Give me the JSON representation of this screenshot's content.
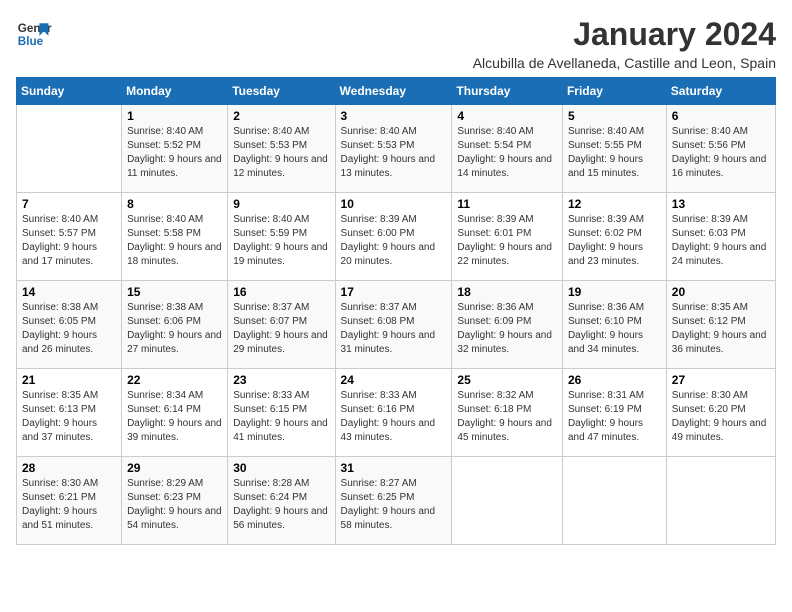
{
  "header": {
    "logo_line1": "General",
    "logo_line2": "Blue",
    "month_title": "January 2024",
    "subtitle": "Alcubilla de Avellaneda, Castille and Leon, Spain"
  },
  "days_of_week": [
    "Sunday",
    "Monday",
    "Tuesday",
    "Wednesday",
    "Thursday",
    "Friday",
    "Saturday"
  ],
  "weeks": [
    [
      {
        "day": "",
        "sunrise": "",
        "sunset": "",
        "daylight": ""
      },
      {
        "day": "1",
        "sunrise": "Sunrise: 8:40 AM",
        "sunset": "Sunset: 5:52 PM",
        "daylight": "Daylight: 9 hours and 11 minutes."
      },
      {
        "day": "2",
        "sunrise": "Sunrise: 8:40 AM",
        "sunset": "Sunset: 5:53 PM",
        "daylight": "Daylight: 9 hours and 12 minutes."
      },
      {
        "day": "3",
        "sunrise": "Sunrise: 8:40 AM",
        "sunset": "Sunset: 5:53 PM",
        "daylight": "Daylight: 9 hours and 13 minutes."
      },
      {
        "day": "4",
        "sunrise": "Sunrise: 8:40 AM",
        "sunset": "Sunset: 5:54 PM",
        "daylight": "Daylight: 9 hours and 14 minutes."
      },
      {
        "day": "5",
        "sunrise": "Sunrise: 8:40 AM",
        "sunset": "Sunset: 5:55 PM",
        "daylight": "Daylight: 9 hours and 15 minutes."
      },
      {
        "day": "6",
        "sunrise": "Sunrise: 8:40 AM",
        "sunset": "Sunset: 5:56 PM",
        "daylight": "Daylight: 9 hours and 16 minutes."
      }
    ],
    [
      {
        "day": "7",
        "sunrise": "Sunrise: 8:40 AM",
        "sunset": "Sunset: 5:57 PM",
        "daylight": "Daylight: 9 hours and 17 minutes."
      },
      {
        "day": "8",
        "sunrise": "Sunrise: 8:40 AM",
        "sunset": "Sunset: 5:58 PM",
        "daylight": "Daylight: 9 hours and 18 minutes."
      },
      {
        "day": "9",
        "sunrise": "Sunrise: 8:40 AM",
        "sunset": "Sunset: 5:59 PM",
        "daylight": "Daylight: 9 hours and 19 minutes."
      },
      {
        "day": "10",
        "sunrise": "Sunrise: 8:39 AM",
        "sunset": "Sunset: 6:00 PM",
        "daylight": "Daylight: 9 hours and 20 minutes."
      },
      {
        "day": "11",
        "sunrise": "Sunrise: 8:39 AM",
        "sunset": "Sunset: 6:01 PM",
        "daylight": "Daylight: 9 hours and 22 minutes."
      },
      {
        "day": "12",
        "sunrise": "Sunrise: 8:39 AM",
        "sunset": "Sunset: 6:02 PM",
        "daylight": "Daylight: 9 hours and 23 minutes."
      },
      {
        "day": "13",
        "sunrise": "Sunrise: 8:39 AM",
        "sunset": "Sunset: 6:03 PM",
        "daylight": "Daylight: 9 hours and 24 minutes."
      }
    ],
    [
      {
        "day": "14",
        "sunrise": "Sunrise: 8:38 AM",
        "sunset": "Sunset: 6:05 PM",
        "daylight": "Daylight: 9 hours and 26 minutes."
      },
      {
        "day": "15",
        "sunrise": "Sunrise: 8:38 AM",
        "sunset": "Sunset: 6:06 PM",
        "daylight": "Daylight: 9 hours and 27 minutes."
      },
      {
        "day": "16",
        "sunrise": "Sunrise: 8:37 AM",
        "sunset": "Sunset: 6:07 PM",
        "daylight": "Daylight: 9 hours and 29 minutes."
      },
      {
        "day": "17",
        "sunrise": "Sunrise: 8:37 AM",
        "sunset": "Sunset: 6:08 PM",
        "daylight": "Daylight: 9 hours and 31 minutes."
      },
      {
        "day": "18",
        "sunrise": "Sunrise: 8:36 AM",
        "sunset": "Sunset: 6:09 PM",
        "daylight": "Daylight: 9 hours and 32 minutes."
      },
      {
        "day": "19",
        "sunrise": "Sunrise: 8:36 AM",
        "sunset": "Sunset: 6:10 PM",
        "daylight": "Daylight: 9 hours and 34 minutes."
      },
      {
        "day": "20",
        "sunrise": "Sunrise: 8:35 AM",
        "sunset": "Sunset: 6:12 PM",
        "daylight": "Daylight: 9 hours and 36 minutes."
      }
    ],
    [
      {
        "day": "21",
        "sunrise": "Sunrise: 8:35 AM",
        "sunset": "Sunset: 6:13 PM",
        "daylight": "Daylight: 9 hours and 37 minutes."
      },
      {
        "day": "22",
        "sunrise": "Sunrise: 8:34 AM",
        "sunset": "Sunset: 6:14 PM",
        "daylight": "Daylight: 9 hours and 39 minutes."
      },
      {
        "day": "23",
        "sunrise": "Sunrise: 8:33 AM",
        "sunset": "Sunset: 6:15 PM",
        "daylight": "Daylight: 9 hours and 41 minutes."
      },
      {
        "day": "24",
        "sunrise": "Sunrise: 8:33 AM",
        "sunset": "Sunset: 6:16 PM",
        "daylight": "Daylight: 9 hours and 43 minutes."
      },
      {
        "day": "25",
        "sunrise": "Sunrise: 8:32 AM",
        "sunset": "Sunset: 6:18 PM",
        "daylight": "Daylight: 9 hours and 45 minutes."
      },
      {
        "day": "26",
        "sunrise": "Sunrise: 8:31 AM",
        "sunset": "Sunset: 6:19 PM",
        "daylight": "Daylight: 9 hours and 47 minutes."
      },
      {
        "day": "27",
        "sunrise": "Sunrise: 8:30 AM",
        "sunset": "Sunset: 6:20 PM",
        "daylight": "Daylight: 9 hours and 49 minutes."
      }
    ],
    [
      {
        "day": "28",
        "sunrise": "Sunrise: 8:30 AM",
        "sunset": "Sunset: 6:21 PM",
        "daylight": "Daylight: 9 hours and 51 minutes."
      },
      {
        "day": "29",
        "sunrise": "Sunrise: 8:29 AM",
        "sunset": "Sunset: 6:23 PM",
        "daylight": "Daylight: 9 hours and 54 minutes."
      },
      {
        "day": "30",
        "sunrise": "Sunrise: 8:28 AM",
        "sunset": "Sunset: 6:24 PM",
        "daylight": "Daylight: 9 hours and 56 minutes."
      },
      {
        "day": "31",
        "sunrise": "Sunrise: 8:27 AM",
        "sunset": "Sunset: 6:25 PM",
        "daylight": "Daylight: 9 hours and 58 minutes."
      },
      {
        "day": "",
        "sunrise": "",
        "sunset": "",
        "daylight": ""
      },
      {
        "day": "",
        "sunrise": "",
        "sunset": "",
        "daylight": ""
      },
      {
        "day": "",
        "sunrise": "",
        "sunset": "",
        "daylight": ""
      }
    ]
  ]
}
